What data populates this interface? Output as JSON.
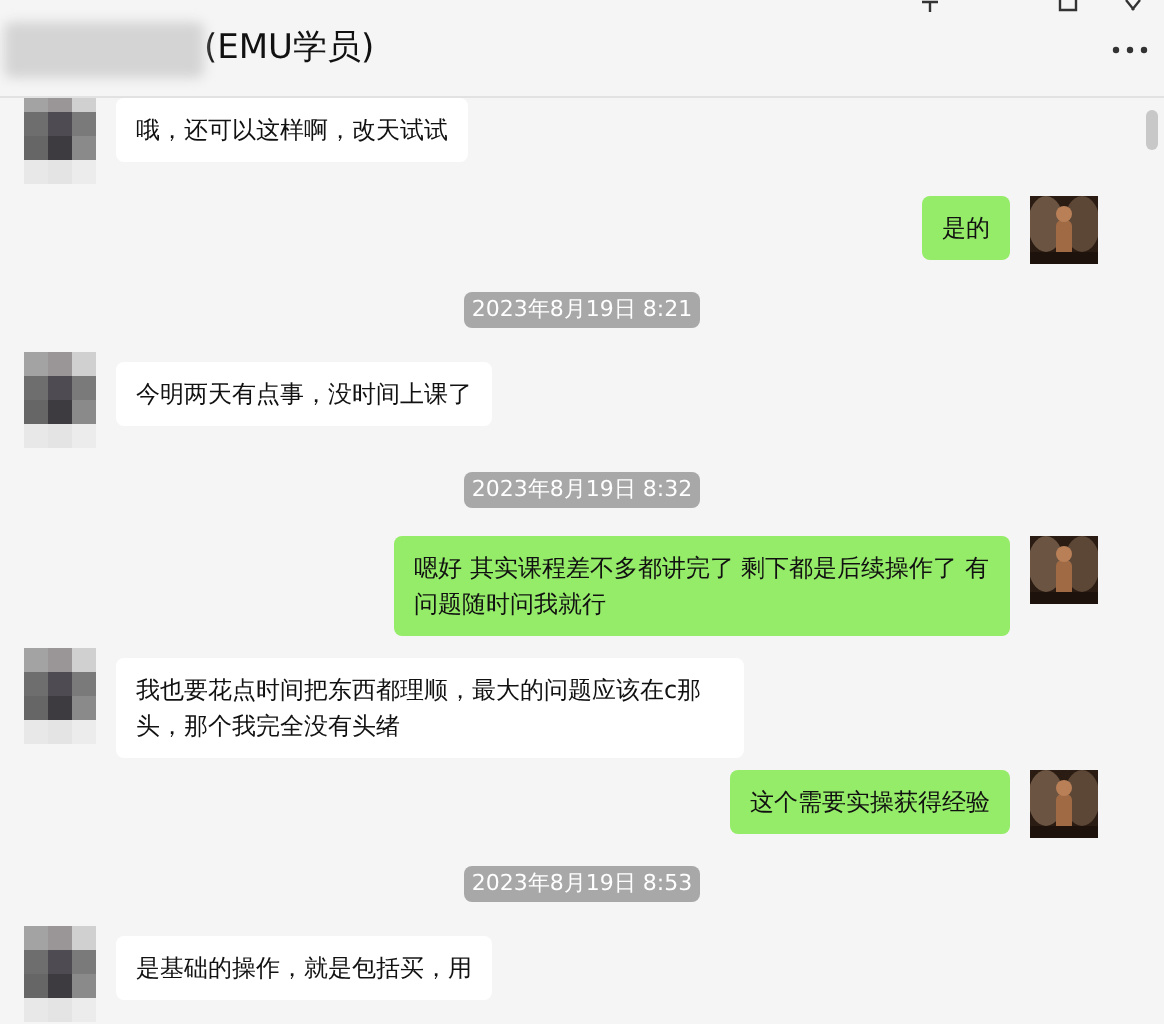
{
  "header": {
    "title": "(EMU学员)"
  },
  "messages": [
    {
      "kind": "incoming",
      "text": "哦，还可以这样啊，改天试试"
    },
    {
      "kind": "outgoing",
      "text": "是的"
    },
    {
      "kind": "timestamp",
      "text": "2023年8月19日 8:21"
    },
    {
      "kind": "incoming",
      "text": "今明两天有点事，没时间上课了"
    },
    {
      "kind": "timestamp",
      "text": "2023年8月19日 8:32"
    },
    {
      "kind": "outgoing",
      "text": "嗯好 其实课程差不多都讲完了 剩下都是后续操作了 有问题随时问我就行"
    },
    {
      "kind": "incoming",
      "text": "我也要花点时间把东西都理顺，最大的问题应该在c那头，那个我完全没有头绪"
    },
    {
      "kind": "outgoing",
      "text": "这个需要实操获得经验"
    },
    {
      "kind": "timestamp",
      "text": "2023年8月19日 8:53"
    },
    {
      "kind": "incoming",
      "text": "是基础的操作，就是包括买，用"
    }
  ]
}
